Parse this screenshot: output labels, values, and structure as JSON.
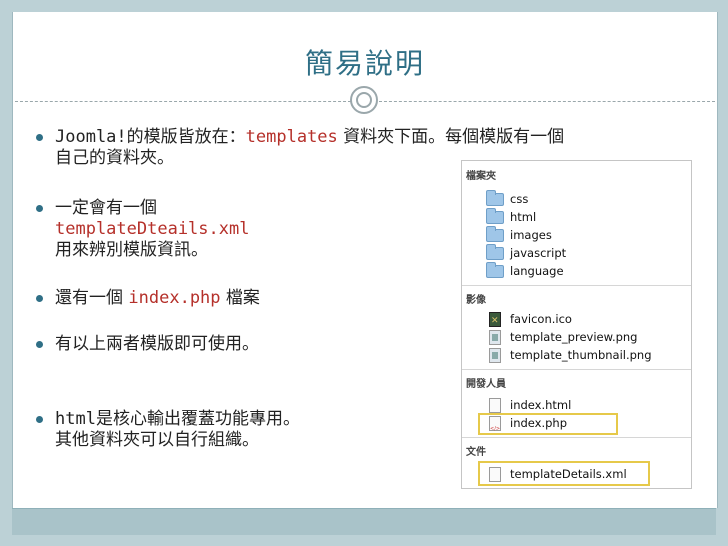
{
  "slide": {
    "title": "簡易說明",
    "bullets": [
      {
        "pre": "Joomla!",
        "mid": "的模版皆放在：",
        "code": "templates",
        "post": " 資料夾下面。每個模版有一個",
        "line2": "自己的資料夾。"
      },
      {
        "line1": "一定會有一個",
        "code": "templateDteails.xml",
        "line3": "用來辨別模版資訊。"
      },
      {
        "pre": "還有一個 ",
        "code": "index.php",
        "post": " 檔案"
      },
      {
        "text": "有以上兩者模版即可使用。"
      },
      {
        "code": "html",
        "post": "是核心輸出覆蓋功能專用。",
        "line2": "其他資料夾可以自行組織。"
      }
    ]
  },
  "browser": {
    "sections": {
      "folders": "檔案夾",
      "images": "影像",
      "developer": "開發人員",
      "documents": "文件"
    },
    "folders": [
      "css",
      "html",
      "images",
      "javascript",
      "language"
    ],
    "images": [
      "favicon.ico",
      "template_preview.png",
      "template_thumbnail.png"
    ],
    "developer": [
      "index.html",
      "index.php"
    ],
    "documents": [
      "templateDetails.xml"
    ]
  },
  "colors": {
    "title": "#2f6f86",
    "code": "#b5302a",
    "highlight": "#e6c94a",
    "background": "#bcd1d6"
  }
}
